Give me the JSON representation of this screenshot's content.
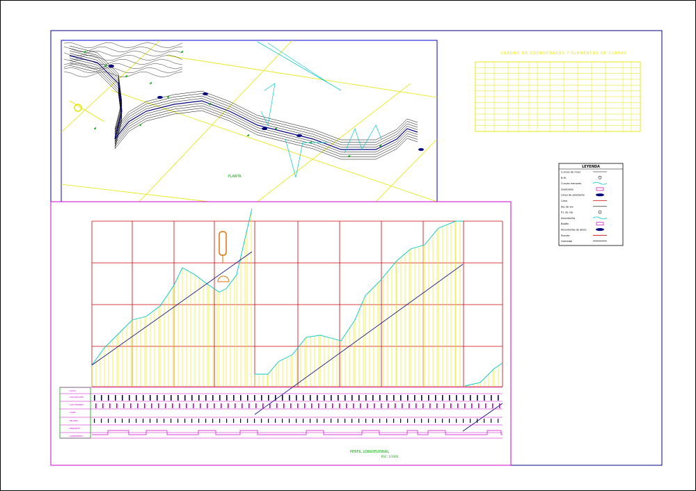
{
  "colors": {
    "background": "#ffffff",
    "outer_frame": "#000080",
    "plan_frame": "#0000cc",
    "profile_frame": "#cc00cc",
    "grid_red": "#cc0000",
    "yellow": "#e6e600",
    "cyan": "#00c8c8",
    "dark_blue": "#000080",
    "magenta": "#cc00cc",
    "green": "#00aa00",
    "black": "#000000",
    "orange": "#e07000"
  },
  "drawing": {
    "plan_label": "PLANTA",
    "profile_label": "PERFIL LONGITUDINAL",
    "profile_scale": "ESC: 1/1000",
    "table_title": "CUADRO DE COORDENADAS Y ELEMENTOS DE CURVAS",
    "legend_title": "LEYENDA",
    "legend_items": [
      {
        "label": "Curvas de nivel",
        "icon": "contour-line-symbol"
      },
      {
        "label": "B.M.",
        "icon": "bench-mark-symbol"
      },
      {
        "label": "Curvas menores",
        "icon": "minor-contour-symbol"
      },
      {
        "label": "Quebrada",
        "icon": "stream-symbol"
      },
      {
        "label": "Linea de gradiente",
        "icon": "gradient-line-symbol"
      },
      {
        "label": "Casa",
        "icon": "house-symbol"
      },
      {
        "label": "Eje de via",
        "icon": "road-axis-symbol"
      },
      {
        "label": "P.I. de via",
        "icon": "pi-symbol"
      },
      {
        "label": "Alcantarilla",
        "icon": "culvert-symbol"
      },
      {
        "label": "Badén",
        "icon": "ford-symbol"
      },
      {
        "label": "Alcantarilla de alivio",
        "icon": "relief-culvert-symbol"
      },
      {
        "label": "Puente",
        "icon": "bridge-symbol"
      },
      {
        "label": "Humedal",
        "icon": "wetland-symbol"
      }
    ],
    "profile_row_labels": [
      "COTAS",
      "COTA RASANTE",
      "COTA TERRENO",
      "CORTE",
      "RELLENO",
      "PENDIENTE",
      "ALINEAMIENTO"
    ]
  }
}
